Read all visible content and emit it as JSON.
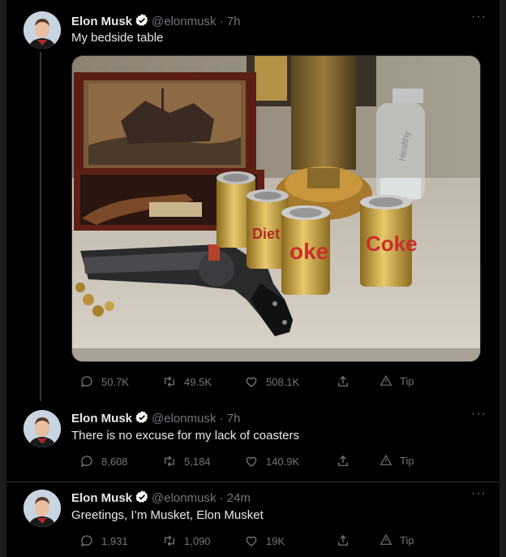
{
  "tweets": [
    {
      "name": "Elon Musk",
      "handle": "@elonmusk",
      "time": "· 7h",
      "text": "My bedside table",
      "media": {
        "can_labels": [
          "Diet",
          "Coke",
          "oke",
          "Diet",
          "Coke",
          "Diet",
          "Coke"
        ],
        "bottle_label": "Healthy"
      },
      "replies": "50.7K",
      "retweets": "49.5K",
      "likes": "508.1K",
      "tip_label": "Tip"
    },
    {
      "name": "Elon Musk",
      "handle": "@elonmusk",
      "time": "· 7h",
      "text": "There is no excuse for my lack of coasters",
      "replies": "8,608",
      "retweets": "5,184",
      "likes": "140.9K",
      "tip_label": "Tip"
    },
    {
      "name": "Elon Musk",
      "handle": "@elonmusk",
      "time": "· 24m",
      "text": "Greetings, I’m Musket, Elon Musket",
      "replies": "1,931",
      "retweets": "1,090",
      "likes": "19K",
      "tip_label": "Tip"
    }
  ],
  "icons": {
    "verified": "verified-badge-icon",
    "more": "more-options-icon",
    "reply": "reply-icon",
    "retweet": "retweet-icon",
    "like": "heart-icon",
    "share": "share-icon",
    "tip": "tip-icon"
  },
  "colors": {
    "background": "#000000",
    "text": "#e7e9ea",
    "secondary": "#71767b",
    "divider": "#2f3336",
    "verified": "#ffffff"
  }
}
